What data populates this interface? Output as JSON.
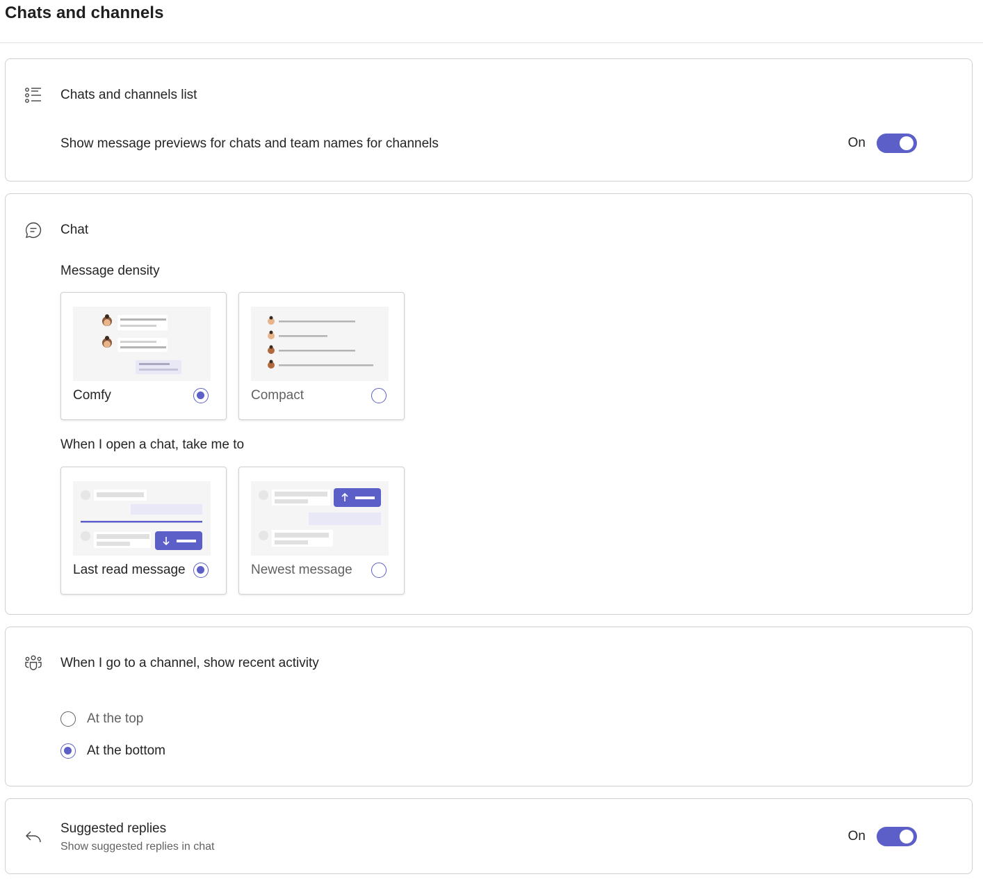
{
  "page": {
    "title": "Chats and channels"
  },
  "list_section": {
    "title": "Chats and channels list",
    "icon": "list-icon",
    "setting_label": "Show message previews for chats and team names for channels",
    "toggle_state": "On"
  },
  "chat_section": {
    "title": "Chat",
    "icon": "chat-icon",
    "density": {
      "label": "Message density",
      "options": [
        {
          "label": "Comfy",
          "selected": true
        },
        {
          "label": "Compact",
          "selected": false
        }
      ]
    },
    "open_chat": {
      "label": "When I open a chat, take me to",
      "options": [
        {
          "label": "Last read message",
          "selected": true
        },
        {
          "label": "Newest message",
          "selected": false
        }
      ]
    }
  },
  "channel_section": {
    "title": "When I go to a channel, show recent activity",
    "icon": "people-icon",
    "options": [
      {
        "label": "At the top",
        "selected": false
      },
      {
        "label": "At the bottom",
        "selected": true
      }
    ]
  },
  "replies_section": {
    "title": "Suggested replies",
    "description": "Show suggested replies in chat",
    "icon": "reply-icon",
    "toggle_state": "On"
  },
  "colors": {
    "accent": "#5b5fc7",
    "border": "#d1d1d1",
    "muted_text": "#616161"
  }
}
